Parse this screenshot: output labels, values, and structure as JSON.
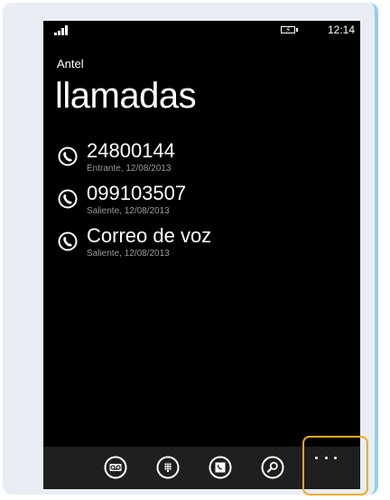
{
  "status_bar": {
    "time": "12:14",
    "icons": [
      "signal-icon",
      "battery-charging-icon"
    ]
  },
  "app": {
    "name": "Antel",
    "title": "llamadas"
  },
  "calls": [
    {
      "number": "24800144",
      "detail": "Entrante, 12/08/2013",
      "icon": "phone-icon"
    },
    {
      "number": "099103507",
      "detail": "Saliente, 12/08/2013",
      "icon": "phone-icon"
    },
    {
      "number": "Correo de voz",
      "detail": "Saliente, 12/08/2013",
      "icon": "phone-icon"
    }
  ],
  "app_bar": {
    "buttons": [
      "voicemail-icon",
      "keypad-icon",
      "contacts-icon",
      "search-icon"
    ],
    "more": "more-options-icon"
  },
  "colors": {
    "screen_background": "#000000",
    "app_bar_background": "#1f1f1f",
    "secondary_text": "#9a9a9a",
    "highlight": "#f4a81c",
    "frame_accent": "#8fd0ee"
  }
}
